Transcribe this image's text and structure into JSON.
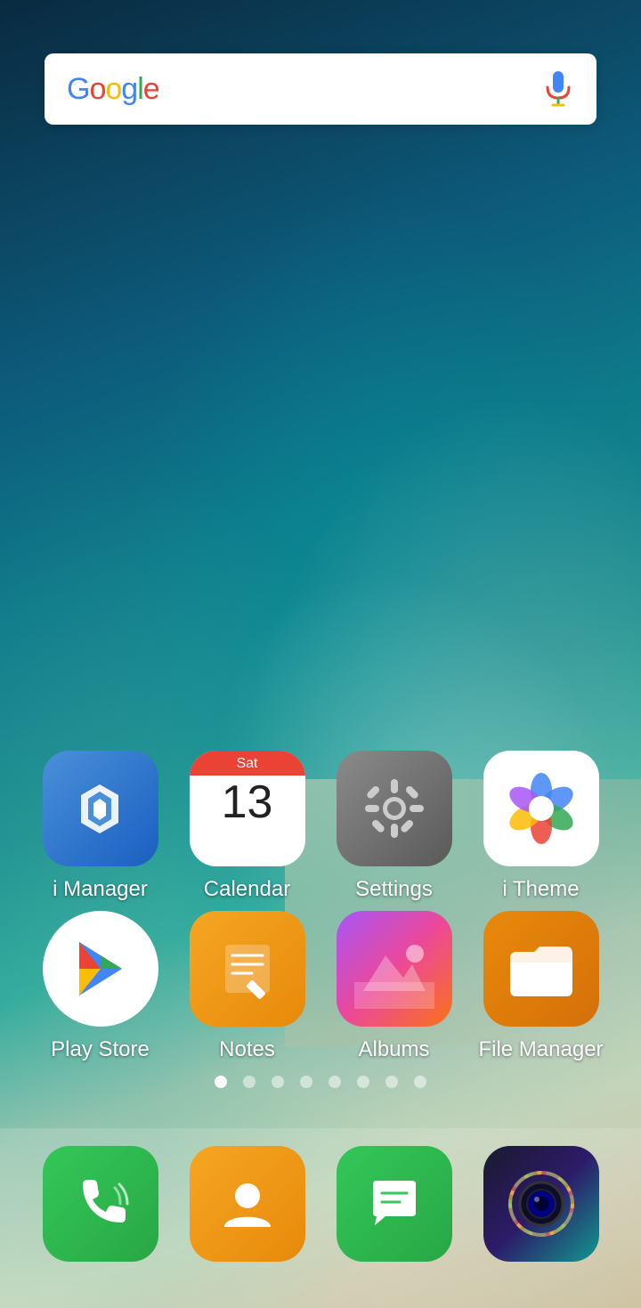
{
  "wallpaper": {
    "description": "ocean beach aerial teal blue"
  },
  "search": {
    "placeholder": "Google",
    "logo": {
      "G": "G",
      "o1": "o",
      "o2": "o",
      "g": "g",
      "l": "l",
      "e": "e"
    },
    "mic_label": "microphone"
  },
  "app_rows": [
    {
      "apps": [
        {
          "id": "imanager",
          "label": "i Manager",
          "icon_type": "imanager"
        },
        {
          "id": "calendar",
          "label": "Calendar",
          "icon_type": "calendar",
          "day": "Sat",
          "date": "13"
        },
        {
          "id": "settings",
          "label": "Settings",
          "icon_type": "settings"
        },
        {
          "id": "itheme",
          "label": "i Theme",
          "icon_type": "itheme"
        }
      ]
    },
    {
      "apps": [
        {
          "id": "playstore",
          "label": "Play Store",
          "icon_type": "playstore"
        },
        {
          "id": "notes",
          "label": "Notes",
          "icon_type": "notes"
        },
        {
          "id": "albums",
          "label": "Albums",
          "icon_type": "albums"
        },
        {
          "id": "filemanager",
          "label": "File Manager",
          "icon_type": "filemanager"
        }
      ]
    }
  ],
  "page_dots": {
    "total": 8,
    "active": 0
  },
  "dock": {
    "apps": [
      {
        "id": "phone",
        "icon_type": "phone"
      },
      {
        "id": "contacts",
        "icon_type": "contacts"
      },
      {
        "id": "messages",
        "icon_type": "messages"
      },
      {
        "id": "camera",
        "icon_type": "camera"
      }
    ]
  }
}
